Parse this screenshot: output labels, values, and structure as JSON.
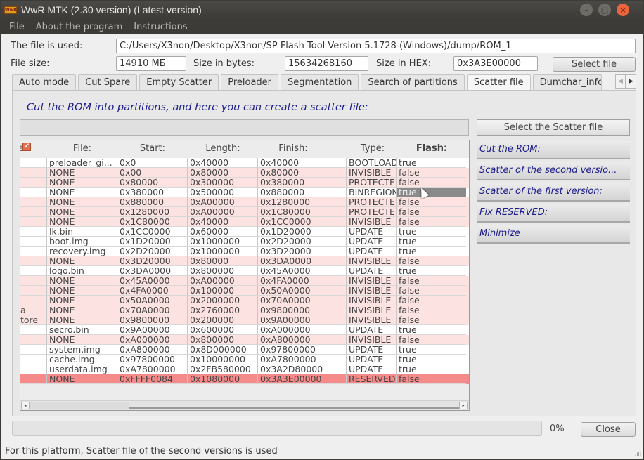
{
  "window": {
    "title": "WwR MTK (2.30 version) (Latest version)",
    "app_icon_text": "WwR",
    "controls": {
      "minimize": "–",
      "maximize": "□",
      "close": "×"
    }
  },
  "menu": [
    "File",
    "About the program",
    "Instructions"
  ],
  "file_info": {
    "file_label": "The file is used:",
    "file_path": "C:/Users/X3non/Desktop/X3non/SP Flash Tool Version 5.1728 (Windows)/dump/ROM_1",
    "size_label": "File size:",
    "size_value": "14910 МБ",
    "bytes_label": "Size in bytes:",
    "bytes_value": "15634268160",
    "hex_label": "Size in HEX:",
    "hex_value": "0x3A3E00000",
    "select_file_button": "Select file"
  },
  "tabs": [
    {
      "label": "Auto mode",
      "active": false
    },
    {
      "label": "Cut Spare",
      "active": false
    },
    {
      "label": "Empty Scatter",
      "active": false
    },
    {
      "label": "Preloader",
      "active": false
    },
    {
      "label": "Segmentation",
      "active": false
    },
    {
      "label": "Search of partitions",
      "active": false
    },
    {
      "label": "Scatter file",
      "active": true
    },
    {
      "label": "Dumchar_info",
      "active": false
    }
  ],
  "tab_scroll": {
    "left": "◀",
    "right": "▶"
  },
  "panel": {
    "heading": "Cut the ROM into partitions, and here you can create a scatter file:",
    "scatter_path": "",
    "select_scatter_button": "Select the Scatter file",
    "actions": [
      "Cut the ROM:",
      "Scatter of the second versio...",
      "Scatter of the first version:",
      "Fix RESERVED:",
      "Minimize"
    ]
  },
  "table": {
    "header_fragment": "e",
    "header_checkbox": "✔",
    "columns": [
      "File:",
      "Start:",
      "Length:",
      "Finish:",
      "Type:",
      "Flash:"
    ],
    "rows": [
      {
        "name": "",
        "file": "preloader_gi...",
        "start": "0x0",
        "length": "0x40000",
        "finish": "0x40000",
        "type": "BOOTLOADE...",
        "flash": "true",
        "style": "white"
      },
      {
        "name": "",
        "file": "NONE",
        "start": "0x00",
        "length": "0x80000",
        "finish": "0x80000",
        "type": "INVISIBLE",
        "flash": "false",
        "style": "pink"
      },
      {
        "name": "",
        "file": "NONE",
        "start": "0x80000",
        "length": "0x300000",
        "finish": "0x380000",
        "type": "PROTECTED",
        "flash": "false",
        "style": "pink"
      },
      {
        "name": "",
        "file": "NONE",
        "start": "0x380000",
        "length": "0x500000",
        "finish": "0x880000",
        "type": "BINREGION",
        "flash": "true",
        "style": "white",
        "selected": true
      },
      {
        "name": "",
        "file": "NONE",
        "start": "0x880000",
        "length": "0xA00000",
        "finish": "0x1280000",
        "type": "PROTECTED",
        "flash": "false",
        "style": "pink"
      },
      {
        "name": "",
        "file": "NONE",
        "start": "0x1280000",
        "length": "0xA00000",
        "finish": "0x1C80000",
        "type": "PROTECTED",
        "flash": "false",
        "style": "pink"
      },
      {
        "name": "",
        "file": "NONE",
        "start": "0x1C80000",
        "length": "0x40000",
        "finish": "0x1CC0000",
        "type": "INVISIBLE",
        "flash": "false",
        "style": "pink"
      },
      {
        "name": "",
        "file": "lk.bin",
        "start": "0x1CC0000",
        "length": "0x60000",
        "finish": "0x1D20000",
        "type": "UPDATE",
        "flash": "true",
        "style": "white"
      },
      {
        "name": "",
        "file": "boot.img",
        "start": "0x1D20000",
        "length": "0x1000000",
        "finish": "0x2D20000",
        "type": "UPDATE",
        "flash": "true",
        "style": "white"
      },
      {
        "name": "",
        "file": "recovery.img",
        "start": "0x2D20000",
        "length": "0x1000000",
        "finish": "0x3D20000",
        "type": "UPDATE",
        "flash": "true",
        "style": "white"
      },
      {
        "name": "",
        "file": "NONE",
        "start": "0x3D20000",
        "length": "0x80000",
        "finish": "0x3DA0000",
        "type": "INVISIBLE",
        "flash": "false",
        "style": "pink"
      },
      {
        "name": "",
        "file": "logo.bin",
        "start": "0x3DA0000",
        "length": "0x800000",
        "finish": "0x45A0000",
        "type": "UPDATE",
        "flash": "true",
        "style": "white"
      },
      {
        "name": "",
        "file": "NONE",
        "start": "0x45A0000",
        "length": "0xA00000",
        "finish": "0x4FA0000",
        "type": "INVISIBLE",
        "flash": "false",
        "style": "pink"
      },
      {
        "name": "",
        "file": "NONE",
        "start": "0x4FA0000",
        "length": "0x100000",
        "finish": "0x50A0000",
        "type": "INVISIBLE",
        "flash": "false",
        "style": "pink"
      },
      {
        "name": "",
        "file": "NONE",
        "start": "0x50A0000",
        "length": "0x2000000",
        "finish": "0x70A0000",
        "type": "INVISIBLE",
        "flash": "false",
        "style": "pink"
      },
      {
        "name": "a",
        "file": "NONE",
        "start": "0x70A0000",
        "length": "0x2760000",
        "finish": "0x9800000",
        "type": "INVISIBLE",
        "flash": "false",
        "style": "pink"
      },
      {
        "name": "tore",
        "file": "NONE",
        "start": "0x9800000",
        "length": "0x200000",
        "finish": "0x9A00000",
        "type": "INVISIBLE",
        "flash": "false",
        "style": "pink"
      },
      {
        "name": "",
        "file": "secro.bin",
        "start": "0x9A00000",
        "length": "0x600000",
        "finish": "0xA000000",
        "type": "UPDATE",
        "flash": "true",
        "style": "white"
      },
      {
        "name": "",
        "file": "NONE",
        "start": "0xA000000",
        "length": "0x800000",
        "finish": "0xA800000",
        "type": "INVISIBLE",
        "flash": "false",
        "style": "pink"
      },
      {
        "name": "",
        "file": "system.img",
        "start": "0xA800000",
        "length": "0x8D000000",
        "finish": "0x97800000",
        "type": "UPDATE",
        "flash": "true",
        "style": "white"
      },
      {
        "name": "",
        "file": "cache.img",
        "start": "0x97800000",
        "length": "0x10000000",
        "finish": "0xA7800000",
        "type": "UPDATE",
        "flash": "true",
        "style": "white"
      },
      {
        "name": "",
        "file": "userdata.img",
        "start": "0xA7800000",
        "length": "0x2FB580000",
        "finish": "0x3A2D80000",
        "type": "UPDATE",
        "flash": "true",
        "style": "white"
      },
      {
        "name": "",
        "file": "NONE",
        "start": "0xFFFF0084",
        "length": "0x1080000",
        "finish": "0x3A3E00000",
        "type": "RESERVED",
        "flash": "false",
        "style": "reserved"
      }
    ],
    "scroll_left": "◂",
    "scroll_right": "▸"
  },
  "progress": {
    "value_percent": 0,
    "label": "0%"
  },
  "close_button": "Close",
  "status_text": "For this platform, Scatter file of the second versions is used",
  "resize_grip": ".ıll"
}
